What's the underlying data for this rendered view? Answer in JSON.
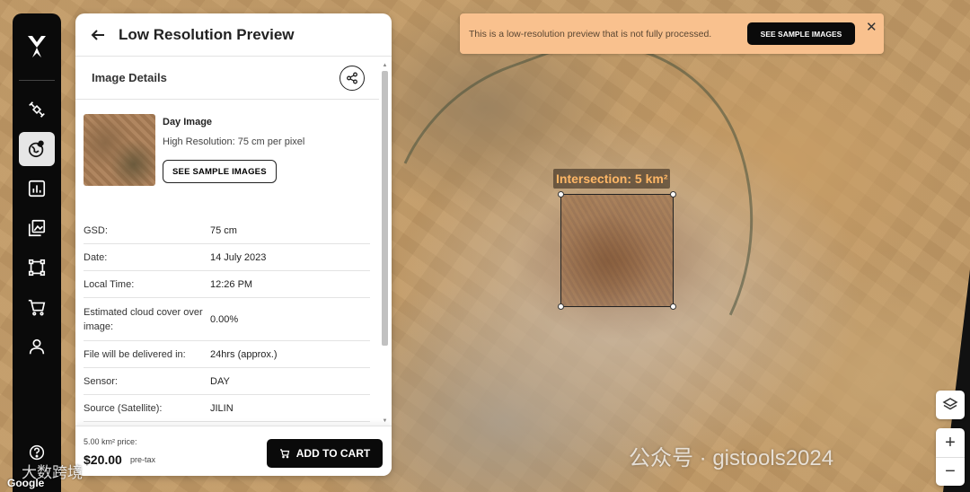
{
  "panel": {
    "title": "Low Resolution Preview",
    "details_title": "Image Details",
    "card": {
      "title": "Day Image",
      "subtitle": "High Resolution: 75 cm per pixel",
      "sample_button": "SEE SAMPLE IMAGES"
    },
    "details": [
      {
        "label": "GSD:",
        "value": "75 cm"
      },
      {
        "label": "Date:",
        "value": "14 July 2023"
      },
      {
        "label": "Local Time:",
        "value": "12:26 PM"
      },
      {
        "label": "Estimated cloud cover over image:",
        "value": "0.00%"
      },
      {
        "label": "File will be delivered in:",
        "value": "24hrs (approx.)"
      },
      {
        "label": "Sensor:",
        "value": "DAY"
      },
      {
        "label": "Source (Satellite):",
        "value": "JILIN"
      }
    ],
    "footer": {
      "price_caption": "5.00 km² price:",
      "price": "$20.00",
      "price_suffix": "pre-tax",
      "cart_button": "ADD TO CART"
    }
  },
  "banner": {
    "text": "This is a low-resolution preview that is not fully processed.",
    "button": "SEE SAMPLE IMAGES",
    "close": "✕"
  },
  "map": {
    "intersection_label": "Intersection: 5 km²",
    "zoom_in": "+",
    "zoom_out": "−",
    "attribution": "Google",
    "watermark": "公众号 · gistools2024",
    "watermark_corner": "大数跨境"
  },
  "nav": {
    "icons": [
      "satellite-icon",
      "globe-icon",
      "chart-icon",
      "gallery-icon",
      "crop-icon",
      "cart-icon",
      "user-icon",
      "help-icon"
    ],
    "active": "globe-icon"
  },
  "colors": {
    "banner_bg": "#f9c18e",
    "intersection_label": "#ffb766",
    "primary_button": "#0a0a0a"
  }
}
